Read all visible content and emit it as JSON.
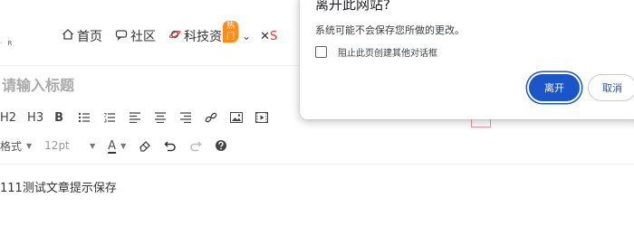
{
  "nav": {
    "logo_fragment": "· R",
    "home": "首页",
    "community": "社区",
    "tech": "科技资讯",
    "hot_badge": "热门",
    "partial": "S"
  },
  "editor": {
    "title_placeholder": "请输入标题",
    "toolbar": {
      "h2": "H2",
      "h3": "H3",
      "bold": "B"
    },
    "format_label": "格式",
    "font_size": "12pt",
    "font_color_label": "A",
    "body_text": "111测试文章提示保存"
  },
  "dialog": {
    "title": "离开此网站?",
    "message": "系统可能不会保存您所做的更改。",
    "checkbox_label": "阻止此页创建其他对话框",
    "leave_label": "离开",
    "cancel_label": "取消"
  },
  "colors": {
    "primary_button": "#1a55c9",
    "hot_badge": "#ff8c1a"
  }
}
